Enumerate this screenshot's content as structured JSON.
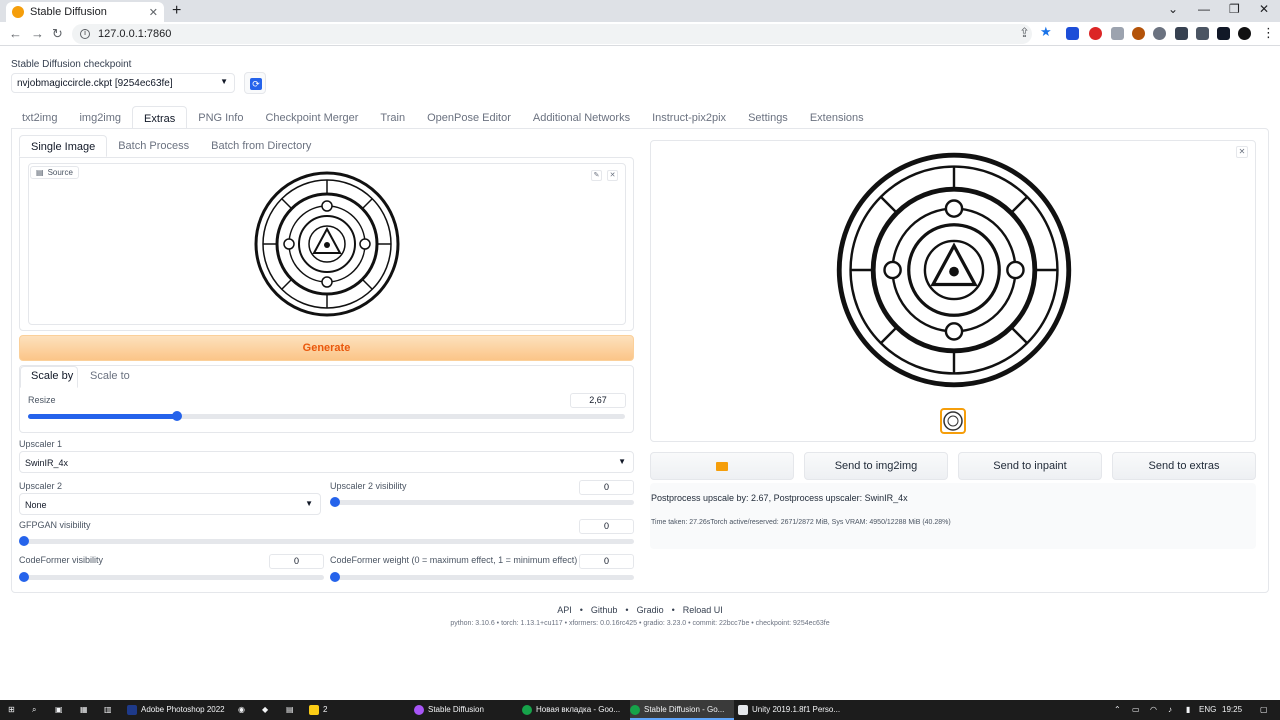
{
  "browser": {
    "tab_title": "Stable Diffusion",
    "new_tab": "+",
    "url": "127.0.0.1:7860"
  },
  "app": {
    "checkpoint_label": "Stable Diffusion checkpoint",
    "checkpoint_value": "nvjobmagiccircle.ckpt [9254ec63fe]",
    "main_tabs": [
      "txt2img",
      "img2img",
      "Extras",
      "PNG Info",
      "Checkpoint Merger",
      "Train",
      "OpenPose Editor",
      "Additional Networks",
      "Instruct-pix2pix",
      "Settings",
      "Extensions"
    ],
    "sub_tabs": [
      "Single Image",
      "Batch Process",
      "Batch from Directory"
    ],
    "source_label": "Source",
    "generate_label": "Generate",
    "scale_tabs": [
      "Scale by",
      "Scale to"
    ],
    "resize_label": "Resize",
    "resize_value": "2,67",
    "resize_fraction": 0.25,
    "upscaler1_label": "Upscaler 1",
    "upscaler1_value": "SwinIR_4x",
    "upscaler2_label": "Upscaler 2",
    "upscaler2_value": "None",
    "upscaler2_vis_label": "Upscaler 2 visibility",
    "upscaler2_vis_value": "0",
    "gfpgan_label": "GFPGAN visibility",
    "gfpgan_value": "0",
    "codeformer_vis_label": "CodeFormer visibility",
    "codeformer_vis_value": "0",
    "codeformer_weight_label": "CodeFormer weight (0 = maximum effect, 1 = minimum effect)",
    "codeformer_weight_value": "0",
    "output_buttons": {
      "send_img2img": "Send to img2img",
      "send_inpaint": "Send to inpaint",
      "send_extras": "Send to extras"
    },
    "info_line1": "Postprocess upscale by: 2.67, Postprocess upscaler: SwinIR_4x",
    "info_line2": "Time taken: 27.26sTorch active/reserved: 2671/2872 MiB, Sys VRAM: 4950/12288 MiB (40.28%)"
  },
  "footer": {
    "links": [
      "API",
      "Github",
      "Gradio",
      "Reload UI"
    ],
    "versions": "python: 3.10.6  •  torch: 1.13.1+cu117  •  xformers: 0.0.16rc425  •  gradio: 3.23.0  •  commit: 22bcc7be  •  checkpoint: 9254ec63fe"
  },
  "taskbar": {
    "items": [
      "Adobe Photoshop 2022",
      "2",
      "Stable Diffusion",
      "Новая вкладка - Goo...",
      "Stable Diffusion - Go...",
      "Unity 2019.1.8f1 Perso..."
    ],
    "lang": "ENG",
    "time": "19:25"
  },
  "colors": {
    "accent": "#2563eb",
    "generate_text": "#ea580c",
    "selected_border": "#f59e0b"
  }
}
